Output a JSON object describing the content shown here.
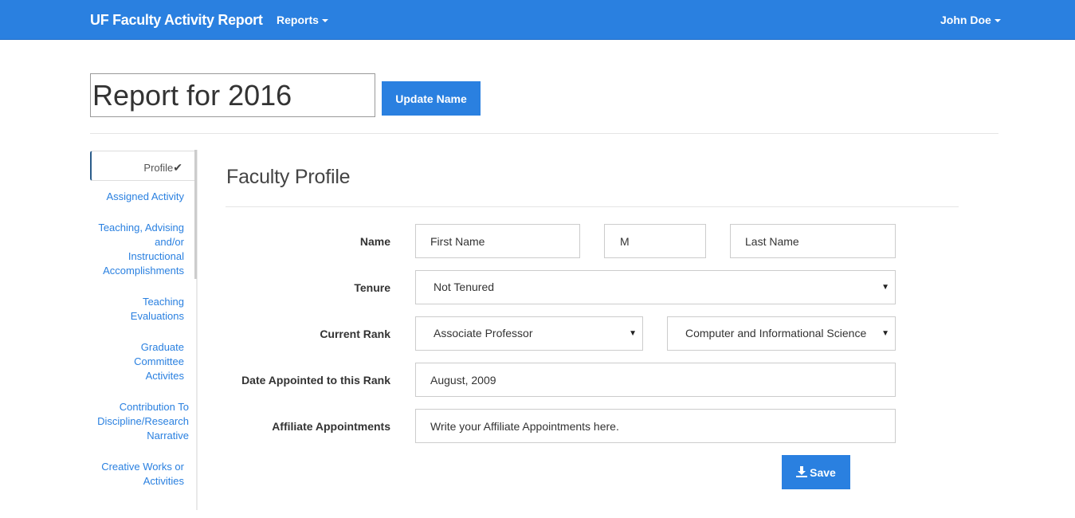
{
  "navbar": {
    "brand": "UF Faculty Activity Report",
    "reports_label": "Reports",
    "user_label": "John Doe"
  },
  "report": {
    "name_value": "Report for 2016",
    "update_button": "Update Name"
  },
  "sidebar": {
    "active_label": "Profile",
    "items": [
      {
        "label": "Assigned Activity"
      },
      {
        "label": "Teaching, Advising and/or Instructional Accomplishments"
      },
      {
        "label": "Teaching Evaluations"
      },
      {
        "label": "Graduate Committee Activites"
      },
      {
        "label": "Contribution To Discipline/Research Narrative"
      },
      {
        "label": "Creative Works or Activities"
      }
    ]
  },
  "profile": {
    "title": "Faculty Profile",
    "name_label": "Name",
    "first_name_value": "First Name",
    "middle_value": "M",
    "last_name_value": "Last Name",
    "tenure_label": "Tenure",
    "tenure_value": "Not Tenured",
    "rank_label": "Current Rank",
    "rank_value": "Associate Professor",
    "department_value": "Computer and Informational Science",
    "date_label": "Date Appointed to this Rank",
    "date_value": "August, 2009",
    "affiliate_label": "Affiliate Appointments",
    "affiliate_value": "Write your Affiliate Appointments here.",
    "save_button": "Save"
  },
  "colors": {
    "primary": "#2a80e0",
    "link": "#2a80e0"
  }
}
